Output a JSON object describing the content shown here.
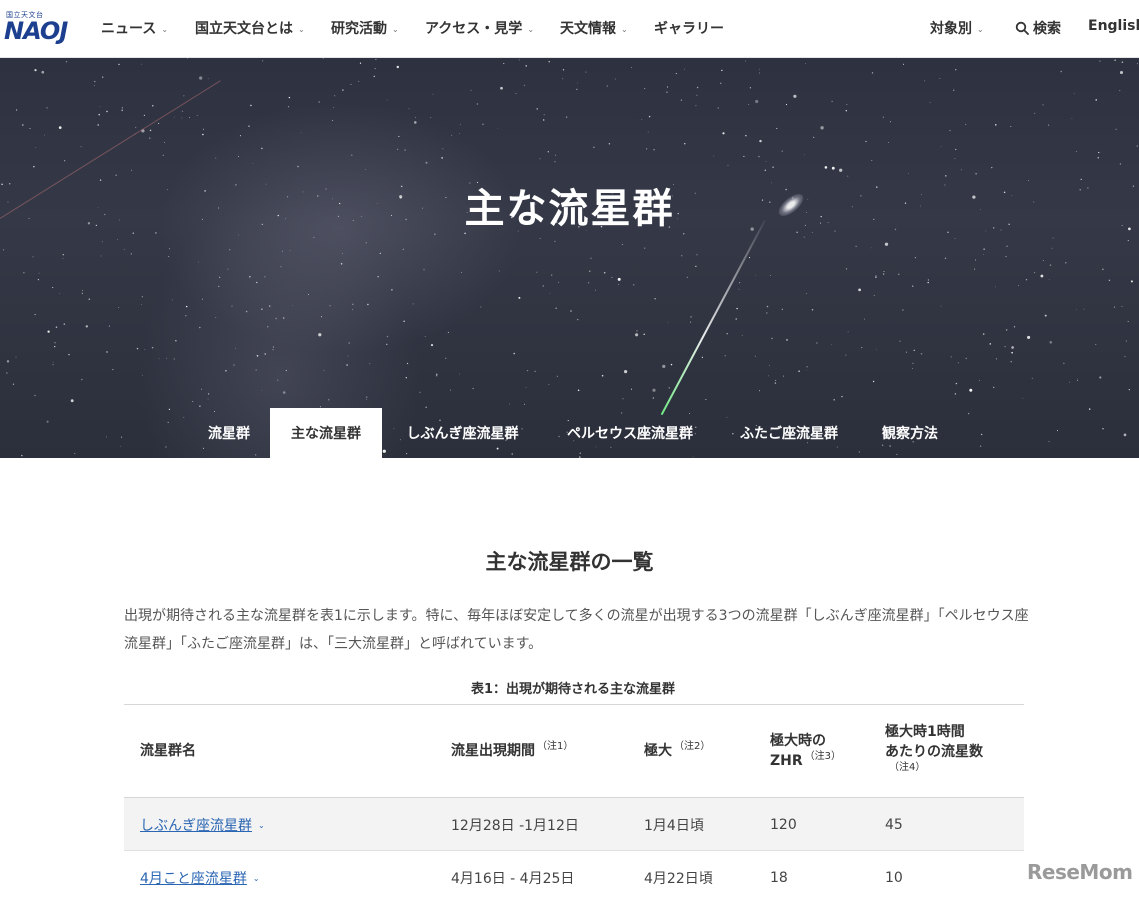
{
  "logo": {
    "small_text": "国立天文台",
    "main_text": "NAOJ"
  },
  "nav": {
    "items": [
      {
        "label": "ニュース"
      },
      {
        "label": "国立天文台とは"
      },
      {
        "label": "研究活動"
      },
      {
        "label": "アクセス・見学"
      },
      {
        "label": "天文情報"
      },
      {
        "label": "ギャラリー"
      }
    ],
    "audience_label": "対象別",
    "search_label": "検索",
    "language_label": "English"
  },
  "hero": {
    "title": "主な流星群",
    "tabs": [
      {
        "label": "流星群"
      },
      {
        "label": "主な流星群"
      },
      {
        "label": "しぶんぎ座流星群"
      },
      {
        "label": "ペルセウス座流星群"
      },
      {
        "label": "ふたご座流星群"
      },
      {
        "label": "観察方法"
      }
    ],
    "active_tab": "主な流星群"
  },
  "content": {
    "section_title": "主な流星群の一覧",
    "intro": "出現が期待される主な流星群を表1に示します。特に、毎年ほぼ安定して多くの流星が出現する3つの流星群「しぶんぎ座流星群」「ペルセウス座流星群」「ふたご座流星群」は、「三大流星群」と呼ばれています。",
    "table_caption": "表1：出現が期待される主な流星群",
    "table": {
      "headers": {
        "name": "流星群名",
        "period": "流星出現期間",
        "period_note": "（注1）",
        "peak": "極大",
        "peak_note": "（注2）",
        "zhr_line1": "極大時の",
        "zhr_line2": "ZHR",
        "zhr_note": "（注3）",
        "rate_line1": "極大時1時間",
        "rate_line2": "あたりの流星数",
        "rate_note": "（注4）"
      },
      "rows": [
        {
          "name": "しぶんぎ座流星群",
          "period": "12月28日 -1月12日",
          "peak": "1月4日頃",
          "zhr": "120",
          "rate": "45"
        },
        {
          "name": "4月こと座流星群",
          "period": "4月16日 - 4月25日",
          "peak": "4月22日頃",
          "zhr": "18",
          "rate": "10"
        }
      ]
    }
  },
  "watermark": "ReseMom"
}
